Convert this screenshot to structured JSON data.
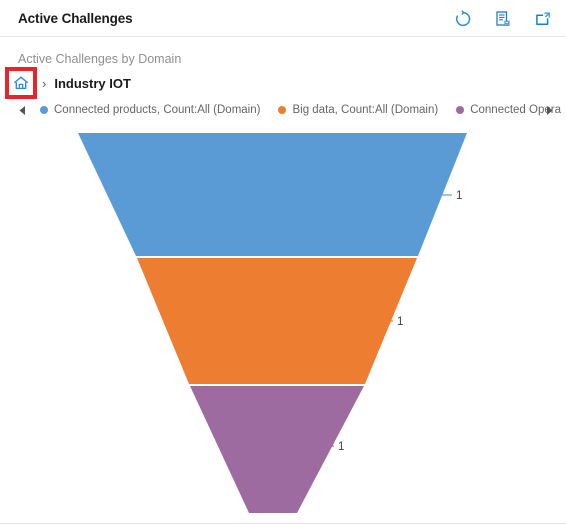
{
  "header": {
    "title": "Active Challenges",
    "actions": [
      {
        "name": "refresh-icon",
        "label": "Refresh"
      },
      {
        "name": "export-icon",
        "label": "Export"
      },
      {
        "name": "popout-icon",
        "label": "Open in new window"
      }
    ]
  },
  "subtitle": "Active Challenges by Domain",
  "breadcrumb": {
    "home_label": "Home",
    "separator": "›",
    "current": "Industry IOT"
  },
  "legend": {
    "prev_label": "◀",
    "next_label": "▶",
    "items": [
      {
        "label": "Connected products, Count:All (Domain)",
        "color": "#5B9BD5"
      },
      {
        "label": "Big data, Count:All (Domain)",
        "color": "#ED7D31"
      },
      {
        "label": "Connected Opera",
        "color": "#9E6BA1"
      }
    ]
  },
  "colors": {
    "blue": "#5B9BD5",
    "orange": "#ED7D31",
    "purple": "#9E6BA1",
    "highlight": "#e8232a",
    "accent": "#0f7bc4",
    "label_text": "#404040"
  },
  "chart_data": {
    "type": "funnel",
    "title": "Active Challenges by Domain",
    "categories": [
      "Connected products, Count:All (Domain)",
      "Big data, Count:All (Domain)",
      "Connected Opera"
    ],
    "values": [
      1,
      1,
      1
    ],
    "value_labels": [
      "1",
      "1",
      "1"
    ],
    "colors": [
      "#5B9BD5",
      "#ED7D31",
      "#9E6BA1"
    ],
    "xlabel": "",
    "ylabel": "",
    "legend_position": "top",
    "grid": false
  }
}
